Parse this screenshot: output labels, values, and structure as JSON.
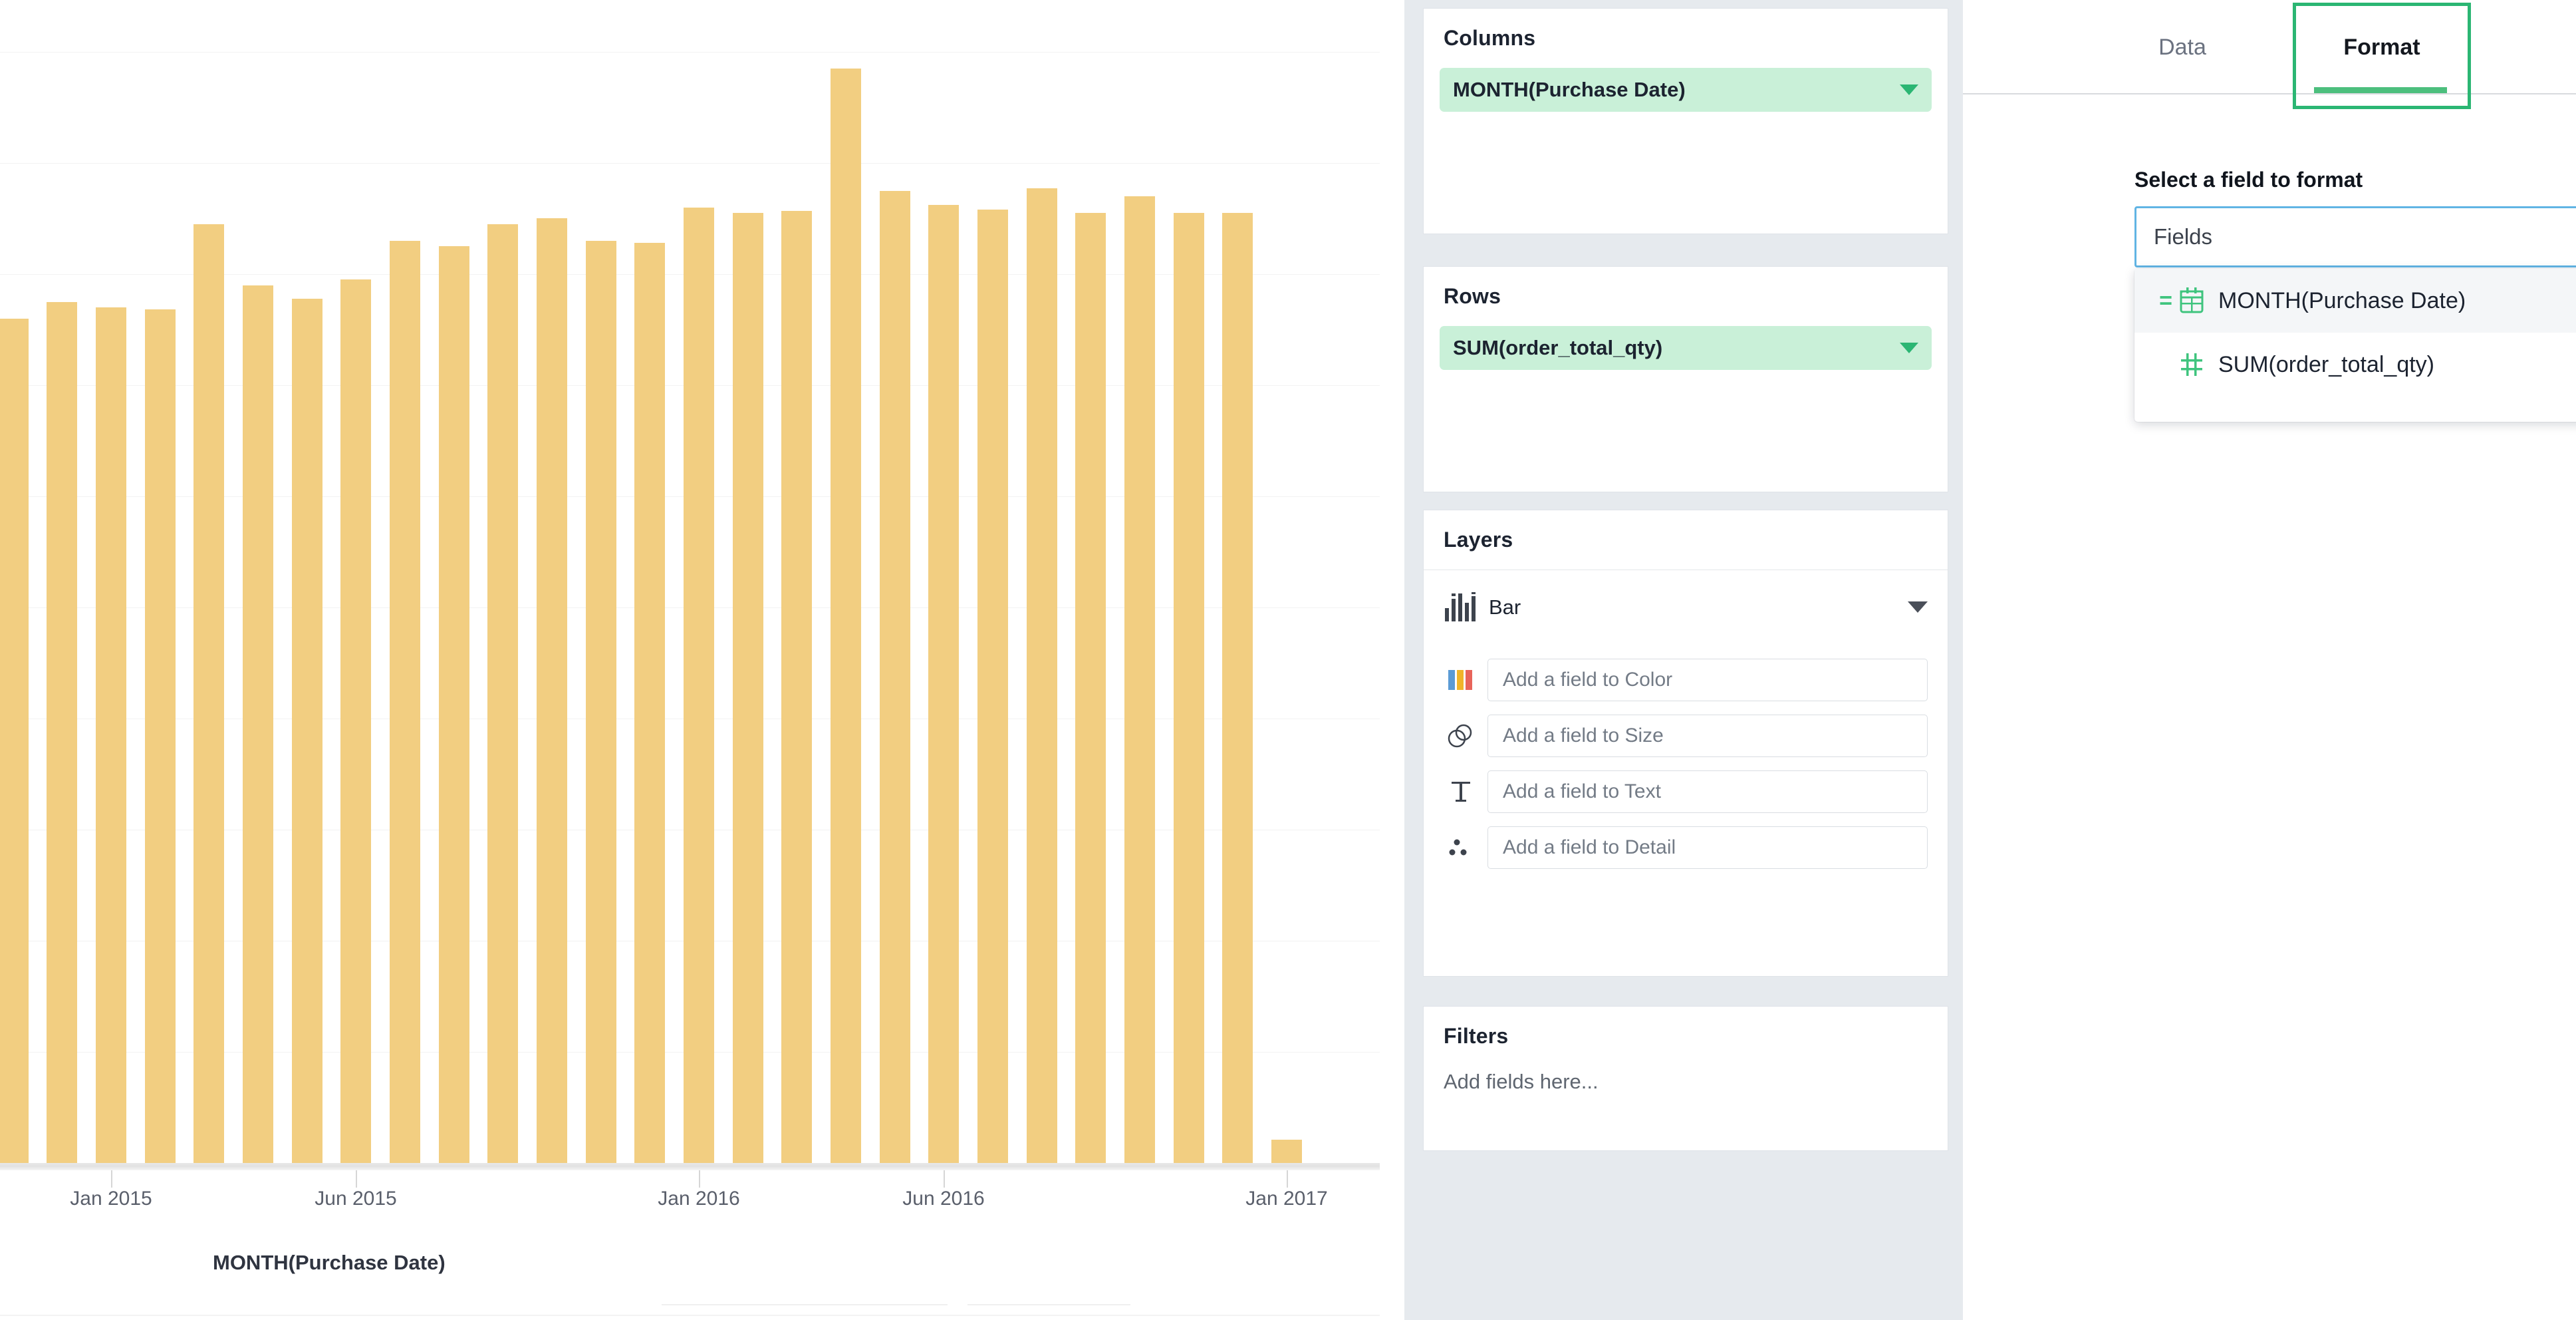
{
  "chart": {
    "axis_title": "MONTH(Purchase Date)",
    "tick_labels": [
      "Jan 2015",
      "Jun 2015",
      "Jan 2016",
      "Jun 2016",
      "Jan 2017"
    ]
  },
  "chart_data": {
    "type": "bar",
    "title": "",
    "xlabel": "MONTH(Purchase Date)",
    "ylabel": "SUM(order_total_qty)",
    "grid": true,
    "legend": "none",
    "axis_tick_labels": [
      "Jan 2015",
      "Jun 2015",
      "Jan 2016",
      "Jun 2016",
      "Jan 2017"
    ],
    "bar_color": "#f2ce81",
    "x_axis_range": [
      "Nov 2014",
      "Jan 2017"
    ],
    "ylim": [
      0,
      10
    ],
    "categories": [
      "Nov 2014",
      "Dec 2014",
      "Jan 2015",
      "Feb 2015",
      "Mar 2015",
      "Apr 2015",
      "May 2015",
      "Jun 2015",
      "Jul 2015",
      "Aug 2015",
      "Sep 2015",
      "Oct 2015",
      "Nov 2015",
      "Dec 2015",
      "Jan 2016",
      "Feb 2016",
      "Mar 2016",
      "Apr 2016",
      "May 2016",
      "Jun 2016",
      "Jul 2016",
      "Aug 2016",
      "Sep 2016",
      "Oct 2016",
      "Nov 2016",
      "Dec 2016",
      "Jan 2017"
    ],
    "values": [
      7.6,
      7.75,
      7.7,
      7.68,
      8.45,
      7.9,
      7.78,
      7.95,
      8.3,
      8.25,
      8.45,
      8.5,
      8.3,
      8.28,
      8.6,
      8.55,
      8.57,
      9.85,
      8.75,
      8.62,
      8.58,
      8.77,
      8.55,
      8.7,
      8.55,
      8.55,
      0.21
    ]
  },
  "shelves": {
    "columns": {
      "title": "Columns",
      "pill_label": "MONTH(Purchase Date)"
    },
    "rows": {
      "title": "Rows",
      "pill_label": "SUM(order_total_qty)"
    },
    "layers": {
      "title": "Layers",
      "mark_type": "Bar",
      "encodings": [
        {
          "icon": "color-swatch-icon",
          "placeholder": "Add a field to Color"
        },
        {
          "icon": "size-circles-icon",
          "placeholder": "Add a field to Size"
        },
        {
          "icon": "text-t-icon",
          "placeholder": "Add a field to Text"
        },
        {
          "icon": "detail-dots-icon",
          "placeholder": "Add a field to Detail"
        }
      ]
    },
    "filters": {
      "title": "Filters",
      "placeholder": "Add fields here..."
    }
  },
  "format_panel": {
    "tabs": [
      {
        "label": "Data",
        "active": false
      },
      {
        "label": "Format",
        "active": true
      }
    ],
    "field_select_label": "Select a field to format",
    "field_select_value": "Fields",
    "dropdown_options": [
      {
        "label": "MONTH(Purchase Date)",
        "prefix": "=",
        "icon": "calendar-icon",
        "hovered": true
      },
      {
        "label": "SUM(order_total_qty)",
        "prefix": "",
        "icon": "hash-number-icon",
        "hovered": false
      }
    ]
  },
  "colors": {
    "bar": "#f2ce81",
    "pill_background": "#c9f0d8",
    "accent_green": "#2bb673",
    "focus_blue": "#61b4e4",
    "panel_background": "#e6eaee"
  }
}
